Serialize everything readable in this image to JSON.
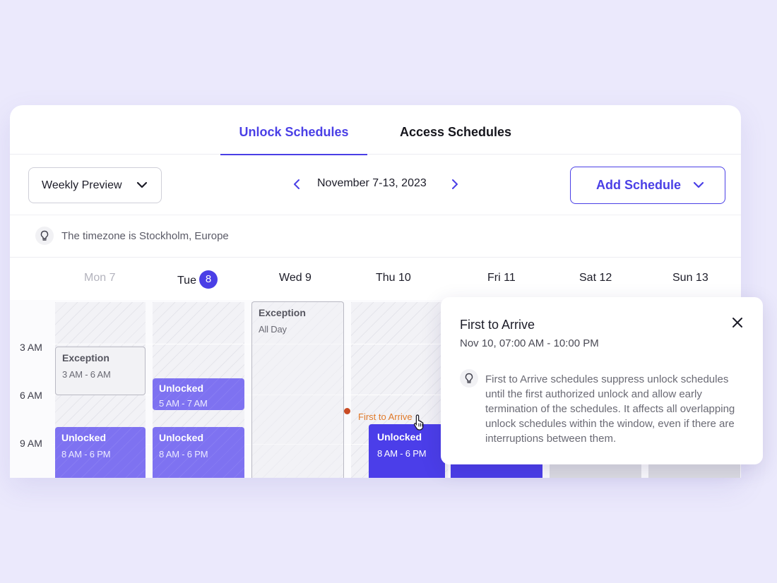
{
  "tabs": [
    {
      "label": "Unlock Schedules",
      "active": true
    },
    {
      "label": "Access Schedules",
      "active": false
    }
  ],
  "toolbar": {
    "view_select": "Weekly Preview",
    "date_range": "November 7-13, 2023",
    "add_button": "Add Schedule"
  },
  "timezone_note": "The timezone is Stockholm, Europe",
  "days": [
    {
      "label": "Mon 7"
    },
    {
      "label": "Tue",
      "badge": "8"
    },
    {
      "label": "Wed 9"
    },
    {
      "label": "Thu 10"
    },
    {
      "label": "Fri 11"
    },
    {
      "label": "Sat 12"
    },
    {
      "label": "Sun 13"
    }
  ],
  "time_labels": [
    "3 AM",
    "6 AM",
    "9 AM"
  ],
  "events": {
    "mon_exception": {
      "title": "Exception",
      "time": "3 AM - 6 AM"
    },
    "mon_unlocked": {
      "title": "Unlocked",
      "time": "8 AM - 6 PM"
    },
    "tue_unlocked_early": {
      "title": "Unlocked",
      "time": "5 AM - 7 AM"
    },
    "tue_unlocked": {
      "title": "Unlocked",
      "time": "8 AM - 6 PM"
    },
    "wed_exception": {
      "title": "Exception",
      "time": "All Day"
    },
    "thu_first_to_arrive": {
      "title": "First to Arrive"
    },
    "thu_unlocked": {
      "title": "Unlocked",
      "time": "8 AM - 6 PM"
    }
  },
  "popover": {
    "title": "First to Arrive",
    "subtitle": "Nov 10, 07:00 AM - 10:00 PM",
    "body": "First to Arrive schedules suppress unlock schedules until the first authorized unlock and allow early termination of the schedules. It affects all overlapping unlock schedules within the window, even if there are interruptions between them."
  },
  "colors": {
    "accent": "#4a3fe6",
    "unlocked": "#7e72f1",
    "first_to_arrive": "#f39a2b",
    "background": "#ebe9fc"
  },
  "icons": {
    "view_select": "chevron-down-icon",
    "prev": "chevron-left-icon",
    "next": "chevron-right-icon",
    "add": "chevron-down-icon",
    "timezone": "lightbulb-icon",
    "close": "close-icon",
    "cursor": "hand-pointer-icon"
  }
}
